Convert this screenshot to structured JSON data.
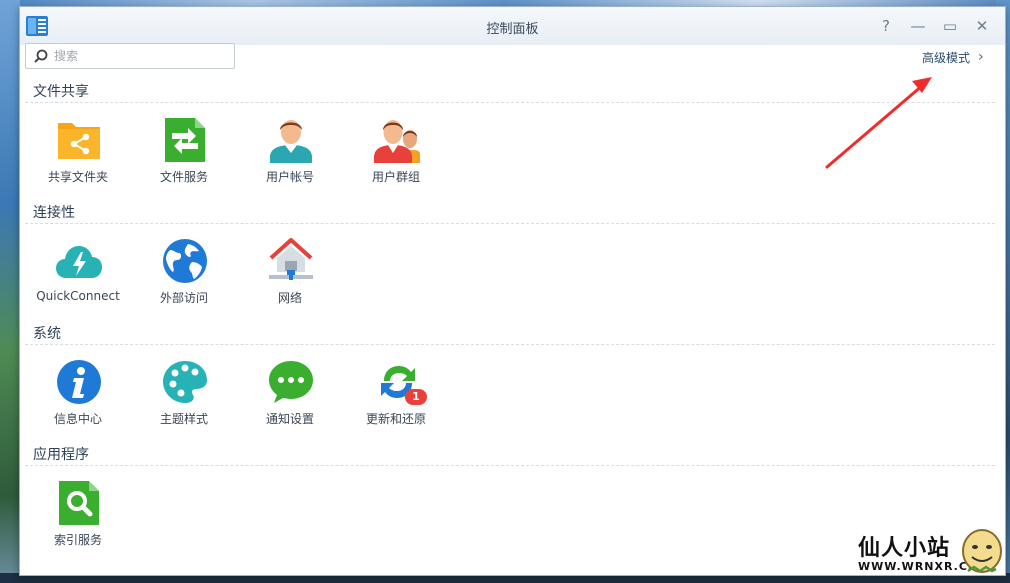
{
  "window": {
    "title": "控制面板",
    "controls": {
      "help": "?",
      "minimize": "—",
      "maximize": "▭",
      "close": "✕"
    }
  },
  "search": {
    "placeholder": "搜索",
    "value": ""
  },
  "advanced_mode": {
    "label": "高级模式",
    "chevron": "›"
  },
  "sections": [
    {
      "title": "文件共享",
      "items": [
        {
          "label": "共享文件夹",
          "icon": "shared-folder-icon"
        },
        {
          "label": "文件服务",
          "icon": "file-services-icon"
        },
        {
          "label": "用户帐号",
          "icon": "user-icon"
        },
        {
          "label": "用户群组",
          "icon": "group-icon"
        }
      ]
    },
    {
      "title": "连接性",
      "items": [
        {
          "label": "QuickConnect",
          "icon": "quickconnect-icon"
        },
        {
          "label": "外部访问",
          "icon": "globe-icon"
        },
        {
          "label": "网络",
          "icon": "network-house-icon"
        }
      ]
    },
    {
      "title": "系统",
      "items": [
        {
          "label": "信息中心",
          "icon": "info-icon"
        },
        {
          "label": "主题样式",
          "icon": "palette-icon"
        },
        {
          "label": "通知设置",
          "icon": "chat-bubble-icon"
        },
        {
          "label": "更新和还原",
          "icon": "update-arrows-icon",
          "badge": "1"
        }
      ]
    },
    {
      "title": "应用程序",
      "items": [
        {
          "label": "索引服务",
          "icon": "index-search-icon"
        }
      ]
    }
  ],
  "watermark": {
    "name": "仙人小站",
    "url": "WWW.WRNXR.CN"
  },
  "colors": {
    "accent_blue": "#1e7ad6",
    "green": "#3aae2f",
    "teal": "#27b3b6",
    "annotation_arrow": "#f02b2b"
  }
}
